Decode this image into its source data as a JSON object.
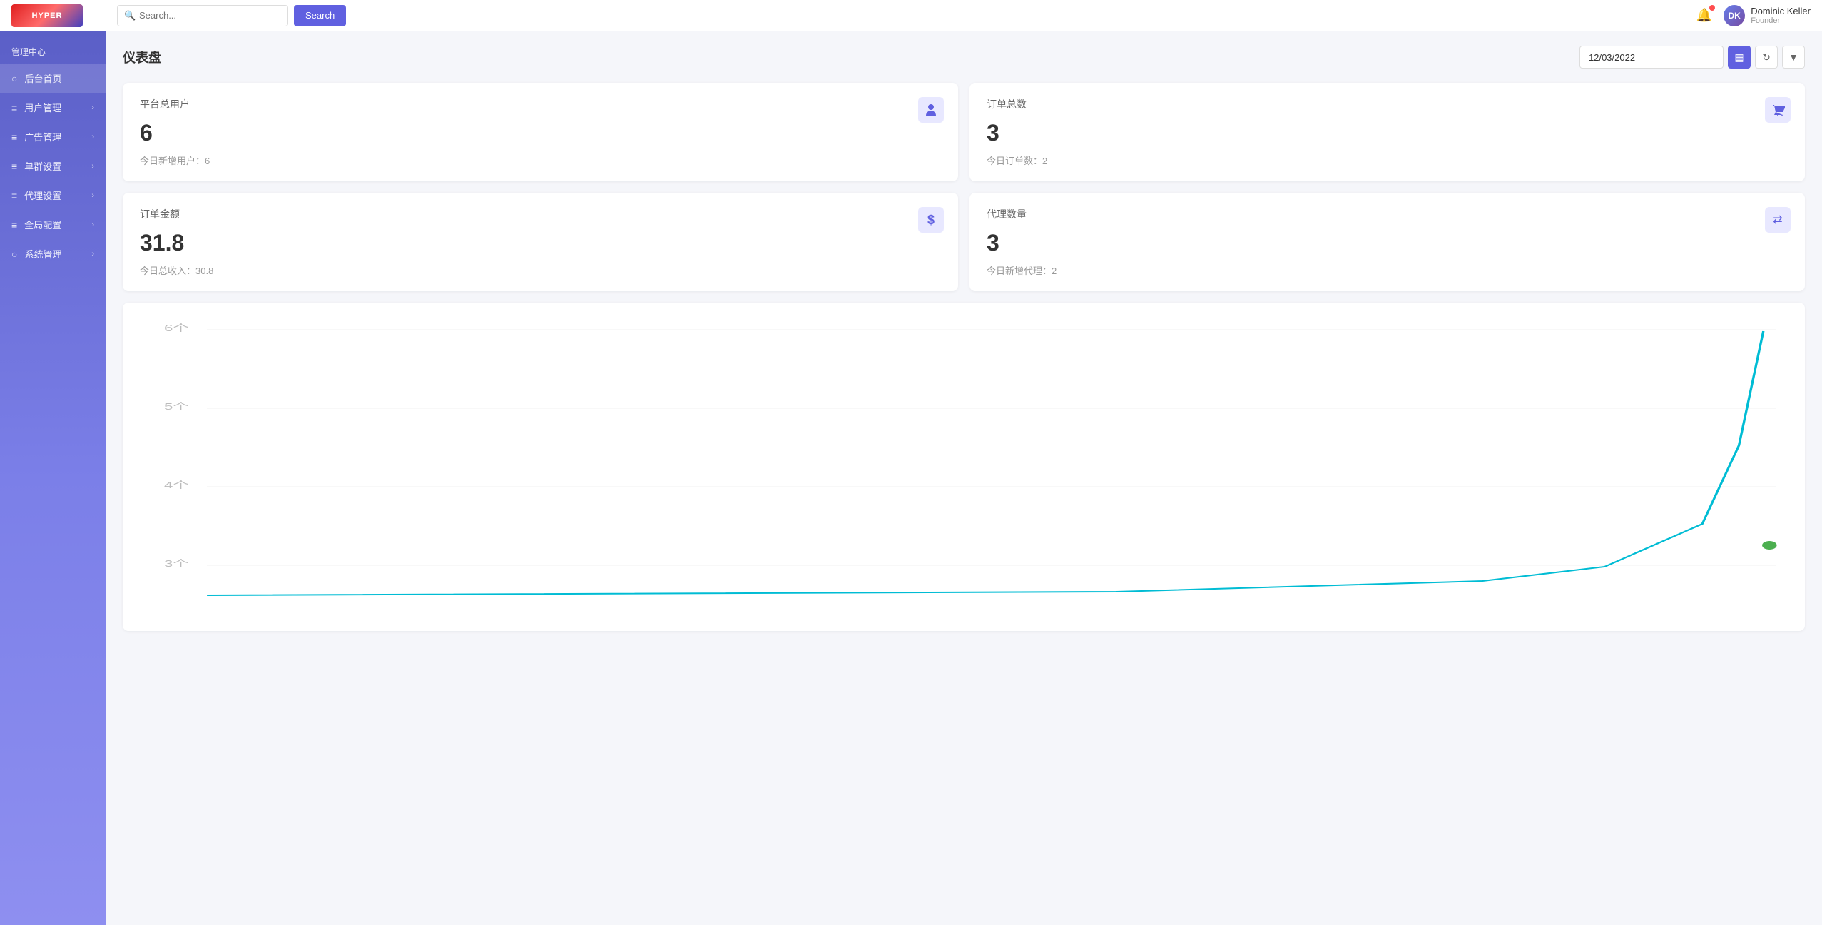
{
  "header": {
    "logo_text": "HYPER",
    "search_placeholder": "Search...",
    "search_btn_label": "Search",
    "bell_icon": "bell",
    "user": {
      "name": "Dominic Keller",
      "role": "Founder",
      "initials": "DK"
    }
  },
  "sidebar": {
    "title": "管理中心",
    "items": [
      {
        "label": "后台首页",
        "icon": "●",
        "arrow": false,
        "active": true
      },
      {
        "label": "用户管理",
        "icon": "☰",
        "arrow": true,
        "active": false
      },
      {
        "label": "广告管理",
        "icon": "☰",
        "arrow": true,
        "active": false
      },
      {
        "label": "单群设置",
        "icon": "☰",
        "arrow": true,
        "active": false
      },
      {
        "label": "代理设置",
        "icon": "☰",
        "arrow": true,
        "active": false
      },
      {
        "label": "全局配置",
        "icon": "☰",
        "arrow": true,
        "active": false
      },
      {
        "label": "系统管理",
        "icon": "●",
        "arrow": true,
        "active": false
      }
    ]
  },
  "page": {
    "title": "仪表盘",
    "date": "12/03/2022"
  },
  "stats": [
    {
      "title": "平台总用户",
      "value": "6",
      "sub": "今日新增用户：6",
      "icon": "👥",
      "icon_name": "users-icon"
    },
    {
      "title": "订单总数",
      "value": "3",
      "sub": "今日订单数：2",
      "icon": "🛒",
      "icon_name": "orders-icon"
    },
    {
      "title": "订单金额",
      "value": "31.8",
      "sub": "今日总收入：30.8",
      "icon": "$",
      "icon_name": "amount-icon"
    },
    {
      "title": "代理数量",
      "value": "3",
      "sub": "今日新增代理：2",
      "icon": "⇄",
      "icon_name": "agents-icon"
    }
  ],
  "chart": {
    "y_labels": [
      "6个",
      "5个",
      "4个",
      "3个"
    ],
    "line_color": "#00bcd4",
    "dot_color": "#4caf50"
  }
}
